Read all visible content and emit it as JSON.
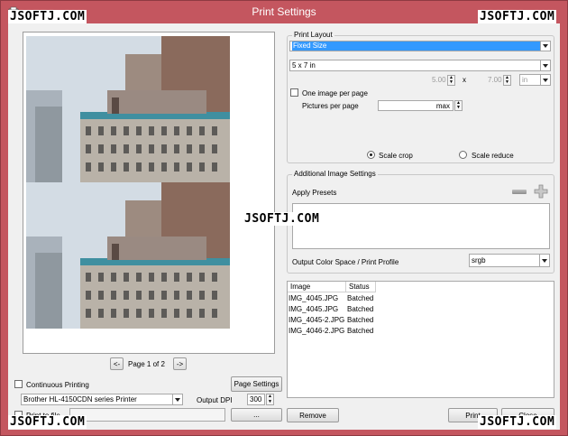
{
  "window": {
    "title": "Print Settings"
  },
  "watermarks": [
    "JSOFTJ.COM",
    "JSOFTJ.COM",
    "JSOFTJ.COM",
    "JSOFTJ.COM",
    "JSOFTJ.COM"
  ],
  "preview": {
    "page_label": "Page",
    "page_current": "1",
    "page_of": "of",
    "page_total": "2",
    "prev": "<-",
    "next": "->"
  },
  "print_layout": {
    "group_title": "Print Layout",
    "layout_value": "Fixed Size",
    "size_value": "5 x 7 in",
    "width_value": "5.00",
    "times": "x",
    "height_value": "7.00",
    "unit_value": "in",
    "one_image_label": "One image per page",
    "pictures_per_page_label": "Pictures per page",
    "pictures_per_page_value": "max",
    "scale_crop": "Scale crop",
    "scale_reduce": "Scale reduce"
  },
  "additional": {
    "group_title": "Additional Image Settings",
    "apply_presets": "Apply Presets",
    "color_label": "Output Color Space / Print Profile",
    "color_value": "srgb"
  },
  "table": {
    "headers": [
      "Image",
      "Status"
    ],
    "rows": [
      {
        "image": "IMG_4045.JPG",
        "status": "Batched"
      },
      {
        "image": "IMG_4045.JPG",
        "status": "Batched"
      },
      {
        "image": "IMG_4045-2.JPG",
        "status": "Batched"
      },
      {
        "image": "IMG_4046-2.JPG",
        "status": "Batched"
      }
    ]
  },
  "bottom": {
    "continuous_printing": "Continuous Printing",
    "page_settings": "Page Settings",
    "printer_value": "Brother HL-4150CDN series Printer",
    "output_dpi_label": "Output DPI",
    "output_dpi_value": "300",
    "print_to_file": "Print to file",
    "browse": "...",
    "remove": "Remove",
    "print": "Print",
    "close": "Close"
  },
  "colors": {
    "title_bar": "#c4565f",
    "selection": "#3399ff",
    "panel": "#f0f0f0"
  }
}
